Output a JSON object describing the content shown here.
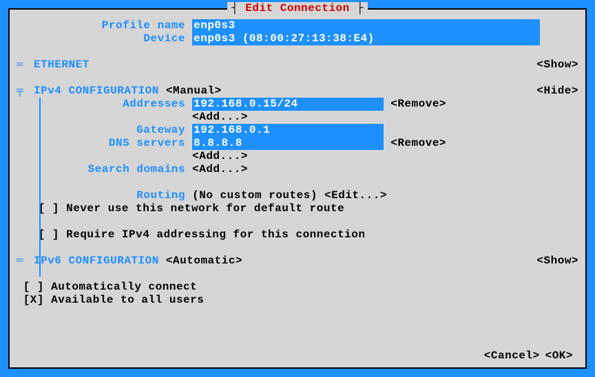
{
  "title": "Edit Connection",
  "profile": {
    "name_label": "Profile name",
    "name_value": "enp0s3",
    "device_label": "Device",
    "device_value": "enp0s3 (08:00:27:13:38:E4)"
  },
  "ethernet": {
    "label": "ETHERNET",
    "toggle": "<Show>"
  },
  "ipv4": {
    "label": "IPv4 CONFIGURATION",
    "mode": "<Manual>",
    "toggle": "<Hide>",
    "addresses_label": "Addresses",
    "address_value": "192.168.0.15/24",
    "remove": "<Remove>",
    "add": "<Add...>",
    "gateway_label": "Gateway",
    "gateway_value": "192.168.0.1",
    "dns_label": "DNS servers",
    "dns_value": "8.8.8.8",
    "search_label": "Search domains",
    "routing_label": "Routing",
    "routing_value_a": "(No custom routes)",
    "routing_edit": "<Edit...>",
    "never_default": "Never use this network for default route",
    "require_ipv4": "Require IPv4 addressing for this connection"
  },
  "ipv6": {
    "label": "IPv6 CONFIGURATION",
    "mode": "<Automatic>",
    "toggle": "<Show>"
  },
  "auto_connect": "Automatically connect",
  "all_users": "Available to all users",
  "cancel": "<Cancel>",
  "ok": "<OK>",
  "checkbox_empty": "[ ]",
  "checkbox_checked": "[X]",
  "marker_eq": "═",
  "marker_top": "╤",
  "marker_bot": "└"
}
